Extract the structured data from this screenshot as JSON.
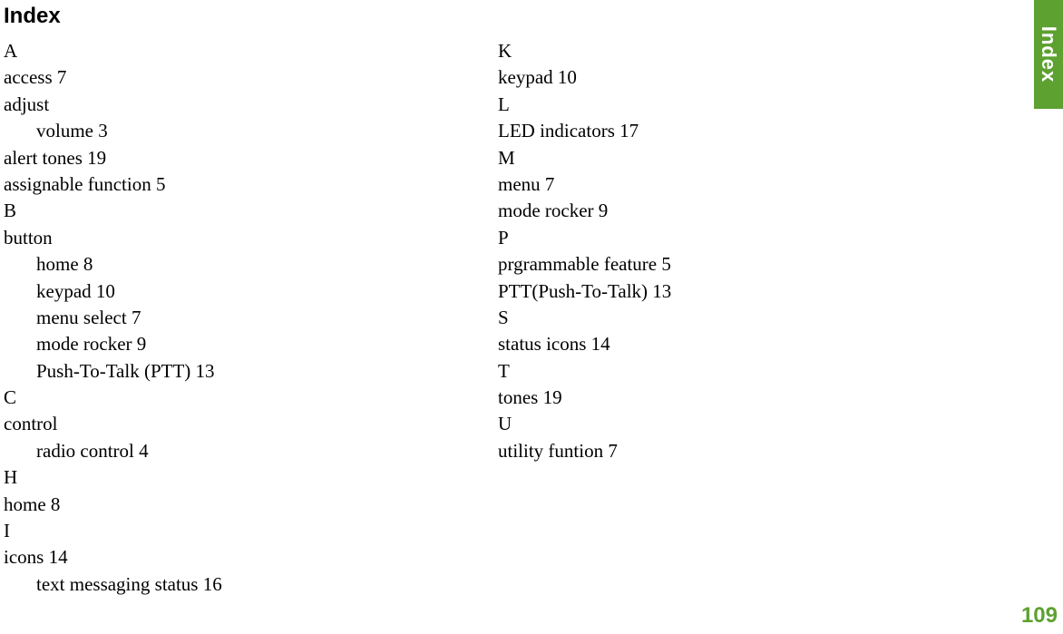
{
  "side_tab": {
    "label": "Index"
  },
  "page_number": "109",
  "title": "Index",
  "left_column": [
    {
      "text": "A",
      "indent": 0
    },
    {
      "text": "access 7",
      "indent": 0
    },
    {
      "text": "adjust",
      "indent": 0
    },
    {
      "text": "volume 3",
      "indent": 1
    },
    {
      "text": "alert tones 19",
      "indent": 0
    },
    {
      "text": "assignable function 5",
      "indent": 0
    },
    {
      "text": "B",
      "indent": 0
    },
    {
      "text": "button",
      "indent": 0
    },
    {
      "text": "home 8",
      "indent": 1
    },
    {
      "text": "keypad 10",
      "indent": 1
    },
    {
      "text": "menu select 7",
      "indent": 1
    },
    {
      "text": "mode rocker 9",
      "indent": 1
    },
    {
      "text": "Push-To-Talk (PTT) 13",
      "indent": 1
    },
    {
      "text": "C",
      "indent": 0
    },
    {
      "text": "control",
      "indent": 0
    },
    {
      "text": "radio control 4",
      "indent": 1
    },
    {
      "text": "H",
      "indent": 0
    },
    {
      "text": "home 8",
      "indent": 0
    },
    {
      "text": "I",
      "indent": 0
    },
    {
      "text": "icons 14",
      "indent": 0
    },
    {
      "text": "text messaging status 16",
      "indent": 1
    }
  ],
  "right_column": [
    {
      "text": "K",
      "indent": 0
    },
    {
      "text": "keypad 10",
      "indent": 0
    },
    {
      "text": "L",
      "indent": 0
    },
    {
      "text": "LED indicators 17",
      "indent": 0
    },
    {
      "text": "M",
      "indent": 0
    },
    {
      "text": "menu 7",
      "indent": 0
    },
    {
      "text": "mode rocker 9",
      "indent": 0
    },
    {
      "text": "P",
      "indent": 0
    },
    {
      "text": "prgrammable feature 5",
      "indent": 0
    },
    {
      "text": "PTT(Push-To-Talk) 13",
      "indent": 0
    },
    {
      "text": "S",
      "indent": 0
    },
    {
      "text": "status icons 14",
      "indent": 0
    },
    {
      "text": "T",
      "indent": 0
    },
    {
      "text": "tones 19",
      "indent": 0
    },
    {
      "text": "U",
      "indent": 0
    },
    {
      "text": "utility funtion 7",
      "indent": 0
    }
  ]
}
